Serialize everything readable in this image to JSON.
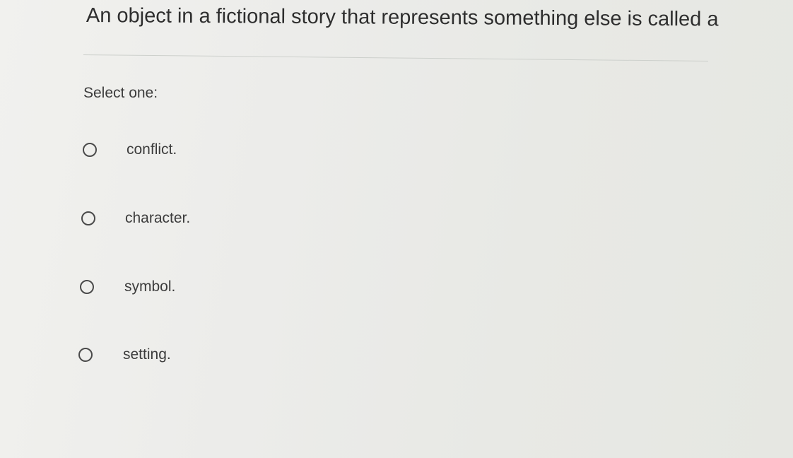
{
  "question": {
    "text": "An object in a fictional story that represents something else is called a"
  },
  "prompt": "Select one:",
  "options": [
    {
      "label": "conflict.",
      "selected": false
    },
    {
      "label": "character.",
      "selected": false
    },
    {
      "label": "symbol.",
      "selected": false
    },
    {
      "label": "setting.",
      "selected": false
    }
  ],
  "colors": {
    "background": "#ececea",
    "text": "#3c3c3c",
    "divider": "#cdd0cc",
    "radio_border": "#4a4a4a"
  }
}
